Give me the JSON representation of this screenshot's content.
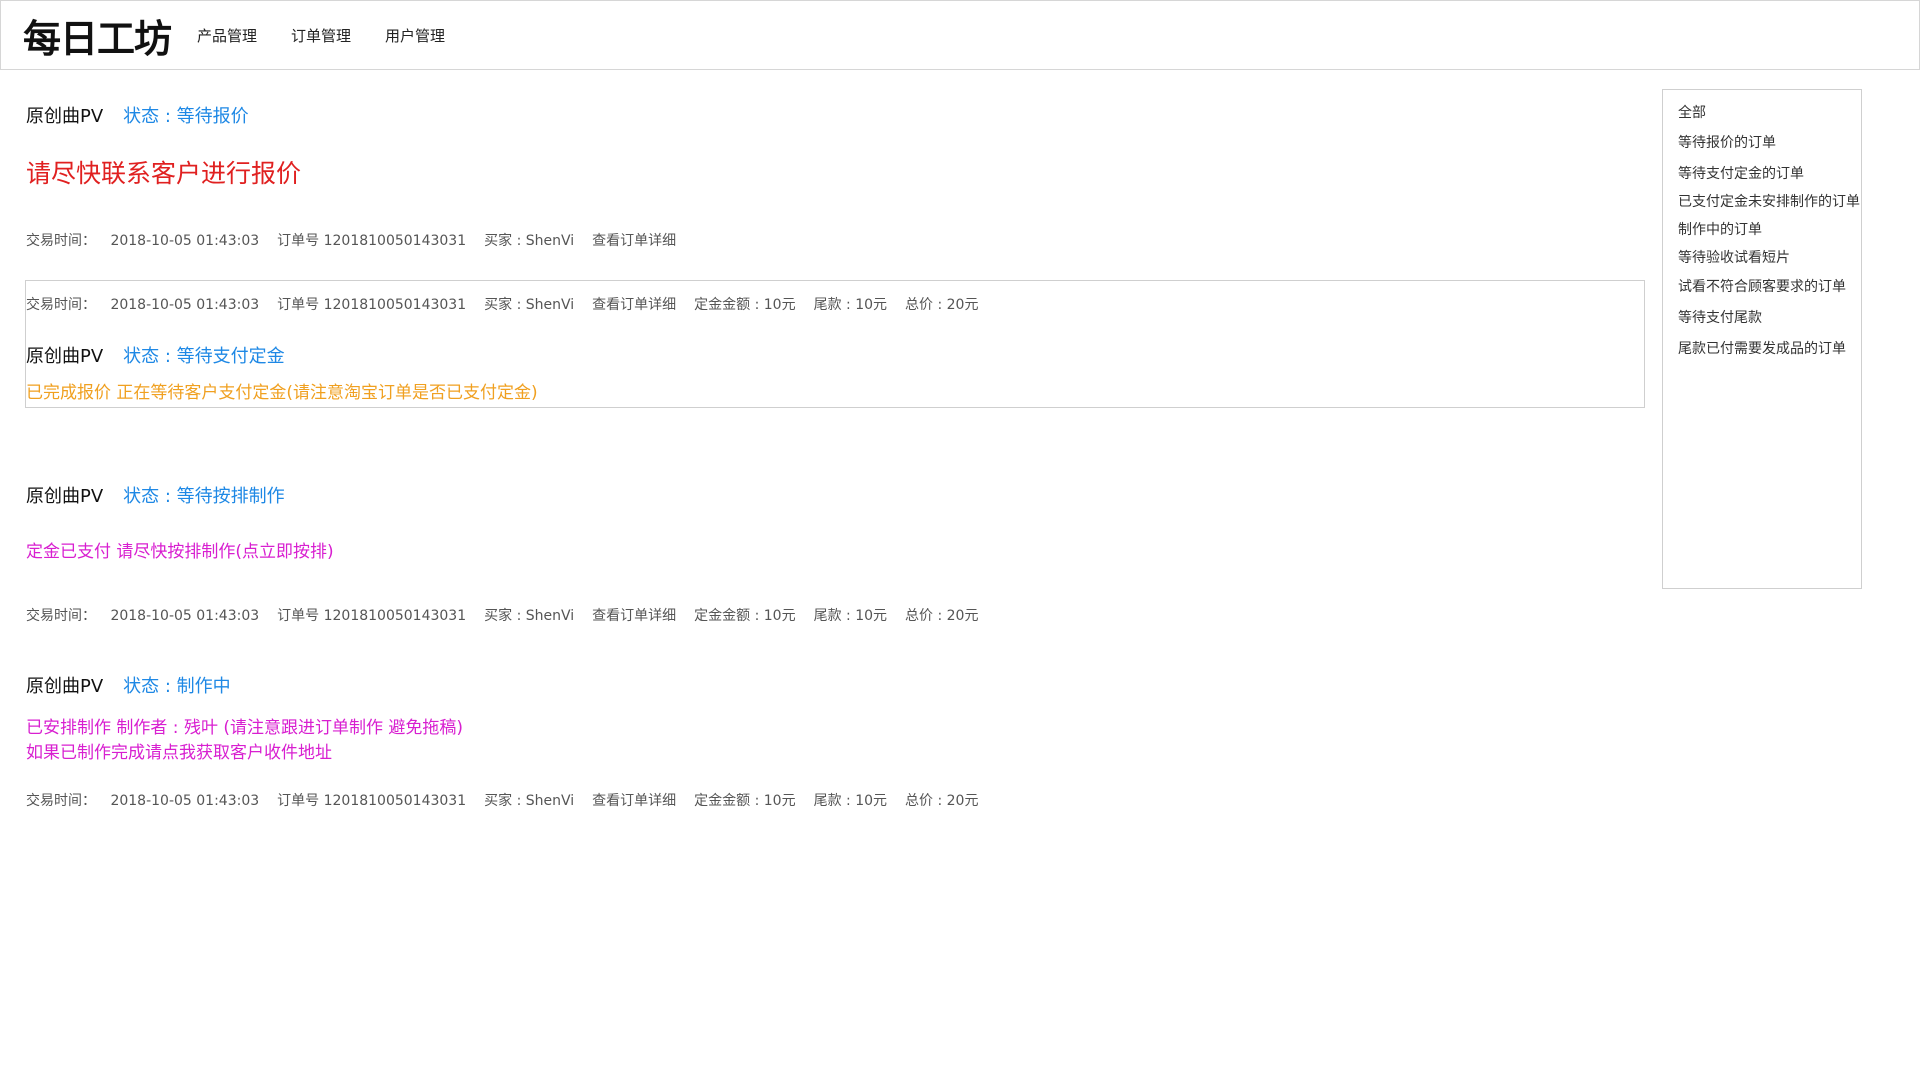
{
  "header": {
    "logo_text": "每日工坊",
    "nav": [
      "产品管理",
      "订单管理",
      "用户管理"
    ]
  },
  "orders": [
    {
      "product": "原创曲PV",
      "status": "状态 : 等待报价",
      "hint_lines": [
        "请尽快联系客户进行报价"
      ],
      "meta": {
        "time_label": "交易时间：",
        "time": "2018-10-05 01:43:03",
        "order_no": "订单号 1201810050143031",
        "buyer": "买家 : ShenVi",
        "detail_link": "查看订单详细"
      }
    },
    {
      "product": "原创曲PV",
      "status": "状态 : 等待支付定金",
      "hint_lines": [
        "已完成报价 正在等待客户支付定金(请注意淘宝订单是否已支付定金)"
      ],
      "meta": {
        "time_label": "交易时间：",
        "time": "2018-10-05 01:43:03",
        "order_no": "订单号 1201810050143031",
        "buyer": "买家 : ShenVi",
        "detail_link": "查看订单详细",
        "deposit": "定金金额 : 10元",
        "balance": "尾款 : 10元",
        "total": "总价 : 20元"
      }
    },
    {
      "product": "原创曲PV",
      "status": "状态 : 等待按排制作",
      "hint_lines": [
        "定金已支付 请尽快按排制作(点立即按排)"
      ],
      "meta": {
        "time_label": "交易时间：",
        "time": "2018-10-05 01:43:03",
        "order_no": "订单号 1201810050143031",
        "buyer": "买家 : ShenVi",
        "detail_link": "查看订单详细",
        "deposit": "定金金额 : 10元",
        "balance": "尾款 : 10元",
        "total": "总价 : 20元"
      }
    },
    {
      "product": "原创曲PV",
      "status": "状态 : 制作中",
      "hint_lines": [
        "已安排制作 制作者 : 残叶  (请注意跟进订单制作 避免拖稿)",
        "如果已制作完成请点我获取客户收件地址"
      ],
      "meta": {
        "time_label": "交易时间：",
        "time": "2018-10-05 01:43:03",
        "order_no": "订单号 1201810050143031",
        "buyer": "买家 : ShenVi",
        "detail_link": "查看订单详细",
        "deposit": "定金金额 : 10元",
        "balance": "尾款 : 10元",
        "total": "总价 : 20元"
      }
    }
  ],
  "sidebar": {
    "items": [
      "全部",
      "等待报价的订单",
      "等待支付定金的订单",
      "已支付定金未安排制作的订单",
      "制作中的订单",
      "等待验收试看短片",
      "试看不符合顾客要求的订单",
      "等待支付尾款",
      "尾款已付需要发成品的订单"
    ]
  },
  "colors": {
    "status_blue": "#1e88e5",
    "hint_red": "#e02020",
    "hint_orange": "#f0a020",
    "hint_magenta": "#d81fd0"
  }
}
